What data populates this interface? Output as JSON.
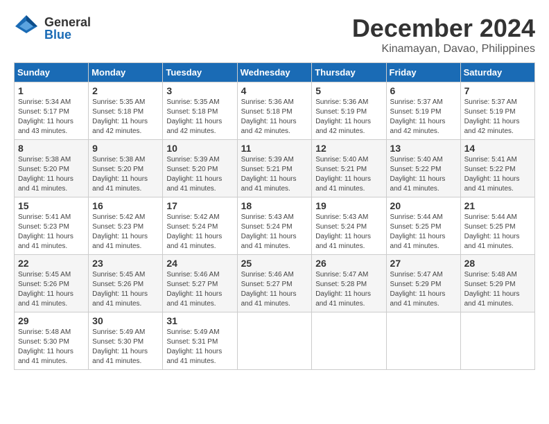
{
  "header": {
    "logo_general": "General",
    "logo_blue": "Blue",
    "month": "December 2024",
    "location": "Kinamayan, Davao, Philippines"
  },
  "days_of_week": [
    "Sunday",
    "Monday",
    "Tuesday",
    "Wednesday",
    "Thursday",
    "Friday",
    "Saturday"
  ],
  "weeks": [
    [
      {
        "day": "1",
        "info": "Sunrise: 5:34 AM\nSunset: 5:17 PM\nDaylight: 11 hours\nand 43 minutes."
      },
      {
        "day": "2",
        "info": "Sunrise: 5:35 AM\nSunset: 5:18 PM\nDaylight: 11 hours\nand 42 minutes."
      },
      {
        "day": "3",
        "info": "Sunrise: 5:35 AM\nSunset: 5:18 PM\nDaylight: 11 hours\nand 42 minutes."
      },
      {
        "day": "4",
        "info": "Sunrise: 5:36 AM\nSunset: 5:18 PM\nDaylight: 11 hours\nand 42 minutes."
      },
      {
        "day": "5",
        "info": "Sunrise: 5:36 AM\nSunset: 5:19 PM\nDaylight: 11 hours\nand 42 minutes."
      },
      {
        "day": "6",
        "info": "Sunrise: 5:37 AM\nSunset: 5:19 PM\nDaylight: 11 hours\nand 42 minutes."
      },
      {
        "day": "7",
        "info": "Sunrise: 5:37 AM\nSunset: 5:19 PM\nDaylight: 11 hours\nand 42 minutes."
      }
    ],
    [
      {
        "day": "8",
        "info": "Sunrise: 5:38 AM\nSunset: 5:20 PM\nDaylight: 11 hours\nand 41 minutes."
      },
      {
        "day": "9",
        "info": "Sunrise: 5:38 AM\nSunset: 5:20 PM\nDaylight: 11 hours\nand 41 minutes."
      },
      {
        "day": "10",
        "info": "Sunrise: 5:39 AM\nSunset: 5:20 PM\nDaylight: 11 hours\nand 41 minutes."
      },
      {
        "day": "11",
        "info": "Sunrise: 5:39 AM\nSunset: 5:21 PM\nDaylight: 11 hours\nand 41 minutes."
      },
      {
        "day": "12",
        "info": "Sunrise: 5:40 AM\nSunset: 5:21 PM\nDaylight: 11 hours\nand 41 minutes."
      },
      {
        "day": "13",
        "info": "Sunrise: 5:40 AM\nSunset: 5:22 PM\nDaylight: 11 hours\nand 41 minutes."
      },
      {
        "day": "14",
        "info": "Sunrise: 5:41 AM\nSunset: 5:22 PM\nDaylight: 11 hours\nand 41 minutes."
      }
    ],
    [
      {
        "day": "15",
        "info": "Sunrise: 5:41 AM\nSunset: 5:23 PM\nDaylight: 11 hours\nand 41 minutes."
      },
      {
        "day": "16",
        "info": "Sunrise: 5:42 AM\nSunset: 5:23 PM\nDaylight: 11 hours\nand 41 minutes."
      },
      {
        "day": "17",
        "info": "Sunrise: 5:42 AM\nSunset: 5:24 PM\nDaylight: 11 hours\nand 41 minutes."
      },
      {
        "day": "18",
        "info": "Sunrise: 5:43 AM\nSunset: 5:24 PM\nDaylight: 11 hours\nand 41 minutes."
      },
      {
        "day": "19",
        "info": "Sunrise: 5:43 AM\nSunset: 5:24 PM\nDaylight: 11 hours\nand 41 minutes."
      },
      {
        "day": "20",
        "info": "Sunrise: 5:44 AM\nSunset: 5:25 PM\nDaylight: 11 hours\nand 41 minutes."
      },
      {
        "day": "21",
        "info": "Sunrise: 5:44 AM\nSunset: 5:25 PM\nDaylight: 11 hours\nand 41 minutes."
      }
    ],
    [
      {
        "day": "22",
        "info": "Sunrise: 5:45 AM\nSunset: 5:26 PM\nDaylight: 11 hours\nand 41 minutes."
      },
      {
        "day": "23",
        "info": "Sunrise: 5:45 AM\nSunset: 5:26 PM\nDaylight: 11 hours\nand 41 minutes."
      },
      {
        "day": "24",
        "info": "Sunrise: 5:46 AM\nSunset: 5:27 PM\nDaylight: 11 hours\nand 41 minutes."
      },
      {
        "day": "25",
        "info": "Sunrise: 5:46 AM\nSunset: 5:27 PM\nDaylight: 11 hours\nand 41 minutes."
      },
      {
        "day": "26",
        "info": "Sunrise: 5:47 AM\nSunset: 5:28 PM\nDaylight: 11 hours\nand 41 minutes."
      },
      {
        "day": "27",
        "info": "Sunrise: 5:47 AM\nSunset: 5:29 PM\nDaylight: 11 hours\nand 41 minutes."
      },
      {
        "day": "28",
        "info": "Sunrise: 5:48 AM\nSunset: 5:29 PM\nDaylight: 11 hours\nand 41 minutes."
      }
    ],
    [
      {
        "day": "29",
        "info": "Sunrise: 5:48 AM\nSunset: 5:30 PM\nDaylight: 11 hours\nand 41 minutes."
      },
      {
        "day": "30",
        "info": "Sunrise: 5:49 AM\nSunset: 5:30 PM\nDaylight: 11 hours\nand 41 minutes."
      },
      {
        "day": "31",
        "info": "Sunrise: 5:49 AM\nSunset: 5:31 PM\nDaylight: 11 hours\nand 41 minutes."
      },
      {
        "day": "",
        "info": ""
      },
      {
        "day": "",
        "info": ""
      },
      {
        "day": "",
        "info": ""
      },
      {
        "day": "",
        "info": ""
      }
    ]
  ]
}
